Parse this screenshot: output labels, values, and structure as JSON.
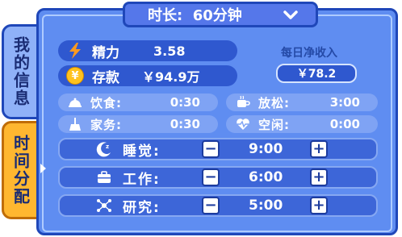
{
  "tabs": {
    "info": "我的信息",
    "time": "时间分配"
  },
  "duration": {
    "label": "时长:",
    "value": "60分钟"
  },
  "stats": {
    "energy": {
      "label": "精力",
      "value": "3.58",
      "icon": "lightning-icon"
    },
    "savings": {
      "label": "存款",
      "value": "￥94.9万",
      "icon": "yen-coin-icon"
    }
  },
  "income": {
    "label": "每日净收入",
    "value": "￥78.2"
  },
  "activities": [
    {
      "label": "饮食:",
      "value": "0:30",
      "icon": "cloche-icon"
    },
    {
      "label": "放松:",
      "value": "3:00",
      "icon": "coffee-icon"
    },
    {
      "label": "家务:",
      "value": "0:30",
      "icon": "broom-icon"
    },
    {
      "label": "空闲:",
      "value": "0:00",
      "icon": "heartbeat-icon"
    }
  ],
  "allocations": [
    {
      "label": "睡觉:",
      "value": "9:00",
      "icon": "moon-icon"
    },
    {
      "label": "工作:",
      "value": "6:00",
      "icon": "briefcase-icon"
    },
    {
      "label": "研究:",
      "value": "5:00",
      "icon": "molecule-icon"
    }
  ],
  "colors": {
    "panel": "#5f8df1",
    "border": "#1f47b9",
    "active_tab": "#ffb730",
    "pill": "#2f58cf"
  }
}
